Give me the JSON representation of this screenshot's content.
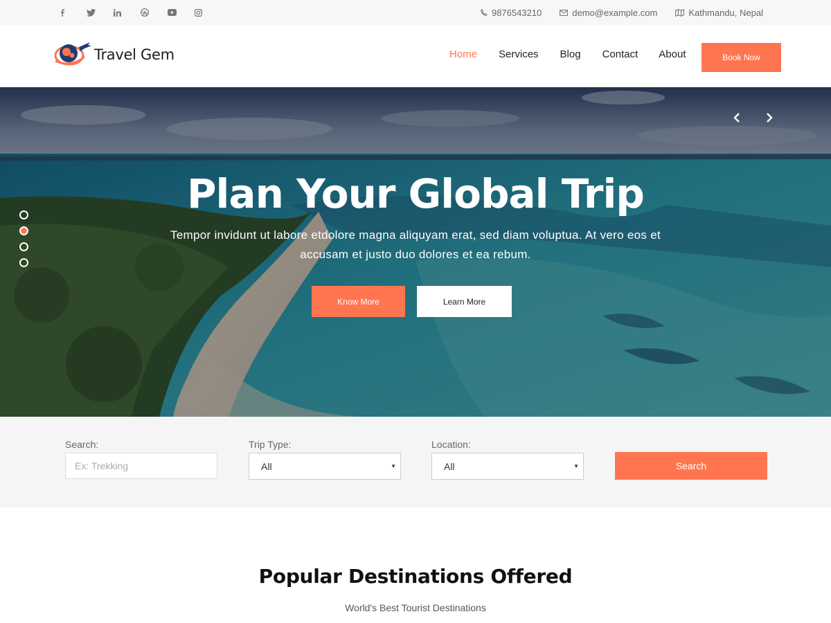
{
  "topbar": {
    "social": [
      "facebook-icon",
      "twitter-icon",
      "linkedin-icon",
      "wordpress-icon",
      "youtube-icon",
      "instagram-icon"
    ],
    "phone": "9876543210",
    "email": "demo@example.com",
    "location": "Kathmandu, Nepal"
  },
  "header": {
    "logo_text": "Travel Gem",
    "nav": [
      "Home",
      "Services",
      "Blog",
      "Contact",
      "About"
    ],
    "active_nav": "Home",
    "book_label": "Book Now"
  },
  "hero": {
    "title": "Plan Your Global Trip",
    "subtitle": "Tempor invidunt ut labore etdolore magna aliquyam erat, sed diam voluptua. At vero eos et accusam et justo duo dolores et ea rebum.",
    "primary_button": "Know More",
    "secondary_button": "Learn More",
    "slides_total": 4,
    "active_slide": 2
  },
  "search": {
    "search_label": "Search:",
    "search_placeholder": "Ex: Trekking",
    "trip_type_label": "Trip Type:",
    "trip_type_value": "All",
    "location_label": "Location:",
    "location_value": "All",
    "button_label": "Search"
  },
  "destinations": {
    "title": "Popular Destinations Offered",
    "subtitle": "World's Best Tourist Destinations"
  },
  "colors": {
    "accent": "#ff7550",
    "topbar_bg": "#f7f7f7",
    "search_bg": "#f5f5f5"
  }
}
